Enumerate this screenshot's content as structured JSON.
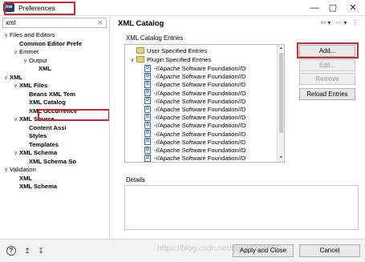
{
  "window": {
    "title": "Preferences",
    "app_icon_text": "me",
    "minimize": "—",
    "maximize": "▢",
    "close": "✕"
  },
  "filter": {
    "value": "xml",
    "clear_icon": "✕"
  },
  "tree": [
    {
      "label": "Files and Editors",
      "expander": "∨",
      "bold": false
    },
    {
      "label": "Common Editor Prefe",
      "expander": "",
      "bold": true
    },
    {
      "label": "Emmet",
      "expander": "∨",
      "bold": false
    },
    {
      "label": "Output",
      "expander": "∨",
      "bold": false
    },
    {
      "label": "XML",
      "expander": "",
      "bold": true
    },
    {
      "label": "XML",
      "expander": "∨",
      "bold": true
    },
    {
      "label": "XML Files",
      "expander": "∨",
      "bold": true
    },
    {
      "label": "Beans XML Tem",
      "expander": "",
      "bold": true
    },
    {
      "label": "XML Catalog",
      "expander": "",
      "bold": true
    },
    {
      "label": "XML Occurrence",
      "expander": "",
      "bold": true
    },
    {
      "label": "XML Source",
      "expander": "∨",
      "bold": true
    },
    {
      "label": "Content Assi",
      "expander": "",
      "bold": true
    },
    {
      "label": "Styles",
      "expander": "",
      "bold": true
    },
    {
      "label": "Templates",
      "expander": "",
      "bold": true
    },
    {
      "label": "XML Schema",
      "expander": "∨",
      "bold": true
    },
    {
      "label": "XML Schema So",
      "expander": "",
      "bold": true
    },
    {
      "label": "Validation",
      "expander": "∨",
      "bold": false
    },
    {
      "label": "XML",
      "expander": "",
      "bold": true
    },
    {
      "label": "XML Schema",
      "expander": "",
      "bold": true
    }
  ],
  "page": {
    "title": "XML Catalog",
    "nav_back": "⇦",
    "nav_back_menu": "▾",
    "nav_forward": "⇨",
    "nav_forward_menu": "▾",
    "view_menu": "⋮"
  },
  "catalog": {
    "group_label": "XML Catalog Entries",
    "user_entries": "User Specified Entries",
    "plugin_entries": "Plugin Specified Entries",
    "plugin_expander": "∨",
    "entry_icon_text": "D",
    "child_entries": [
      "-//Apache Software Foundation//D",
      "-//Apache Software Foundation//D",
      "-//Apache Software Foundation//D",
      "-//Apache Software Foundation//D",
      "-//Apache Software Foundation//D",
      "-//Apache Software Foundation//D",
      "-//Apache Software Foundation//D",
      "-//Apache Software Foundation//D",
      "-//Apache Software Foundation//D",
      "-//Apache Software Foundation//D",
      "-//Apache Software Foundation//D",
      "-//Apache Software Foundation//D"
    ],
    "scroll_up": "▴",
    "scroll_down": "▾"
  },
  "buttons": {
    "add": "Add...",
    "edit": "Edit...",
    "remove": "Remove",
    "reload": "Reload Entries"
  },
  "details": {
    "label": "Details"
  },
  "bottom": {
    "help_icon": "?",
    "import_icon": "↥",
    "export_icon": "↧",
    "apply_close": "Apply and Close",
    "cancel": "Cancel"
  },
  "watermark": "https://blog.csdn.net/qq_46371656"
}
